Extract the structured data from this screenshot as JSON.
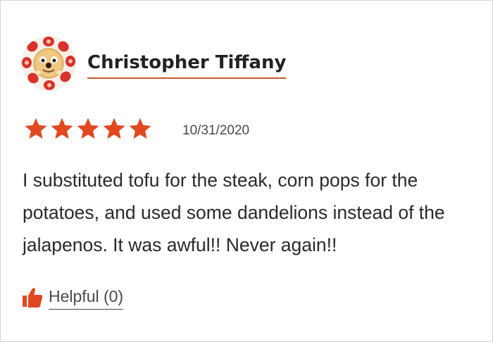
{
  "review": {
    "reviewer_name": "Christopher Tiffany",
    "avatar_icon": "pancake-face-avatar",
    "rating": 5,
    "rating_max": 5,
    "date": "10/31/2020",
    "text": "I substituted tofu for the steak, corn pops for the potatoes, and used some dandelions instead of the jalapenos. It was awful!! Never again!!",
    "helpful_label": "Helpful (0)"
  },
  "colors": {
    "star": "#e0481f",
    "thumb": "#e0481f",
    "name_underline": "#c7592a"
  }
}
